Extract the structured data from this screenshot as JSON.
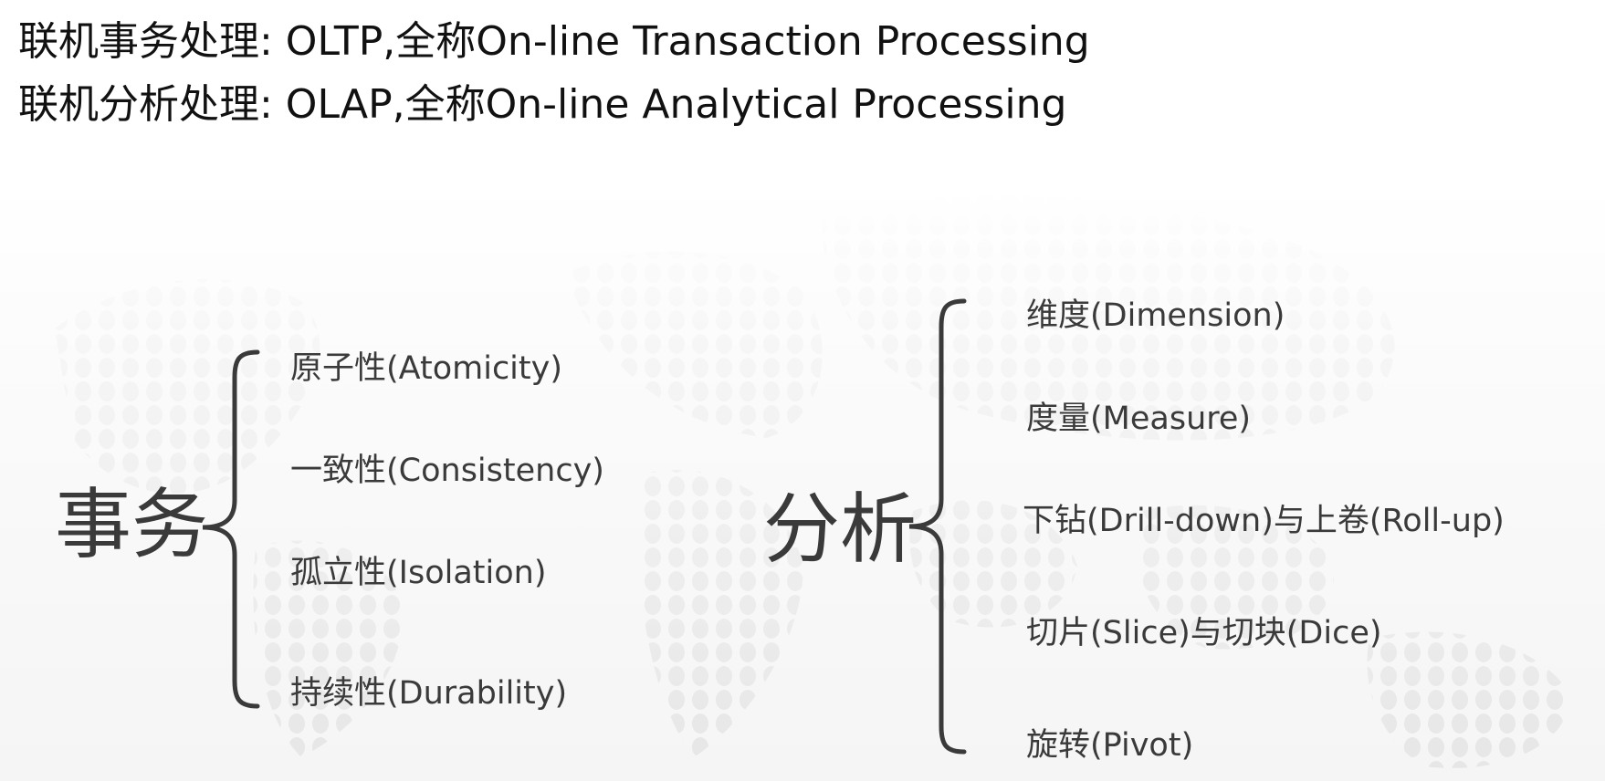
{
  "header": {
    "oltp": "联机事务处理: OLTP,全称On-line Transaction Processing",
    "olap": "联机分析处理: OLAP,全称On-line Analytical Processing"
  },
  "transaction": {
    "title": "事务",
    "items": [
      "原子性(Atomicity)",
      "一致性(Consistency)",
      "孤立性(Isolation)",
      "持续性(Durability)"
    ]
  },
  "analysis": {
    "title": "分析",
    "items": [
      "维度(Dimension)",
      "度量(Measure)",
      "下钻(Drill-down)与上卷(Roll-up)",
      "切片(Slice)与切块(Dice)",
      "旋转(Pivot)"
    ]
  },
  "colors": {
    "text_dark": "#111111",
    "text_gray": "#3a3a3a",
    "brace": "#3a3a3a",
    "dots": "#e9e9e9"
  }
}
